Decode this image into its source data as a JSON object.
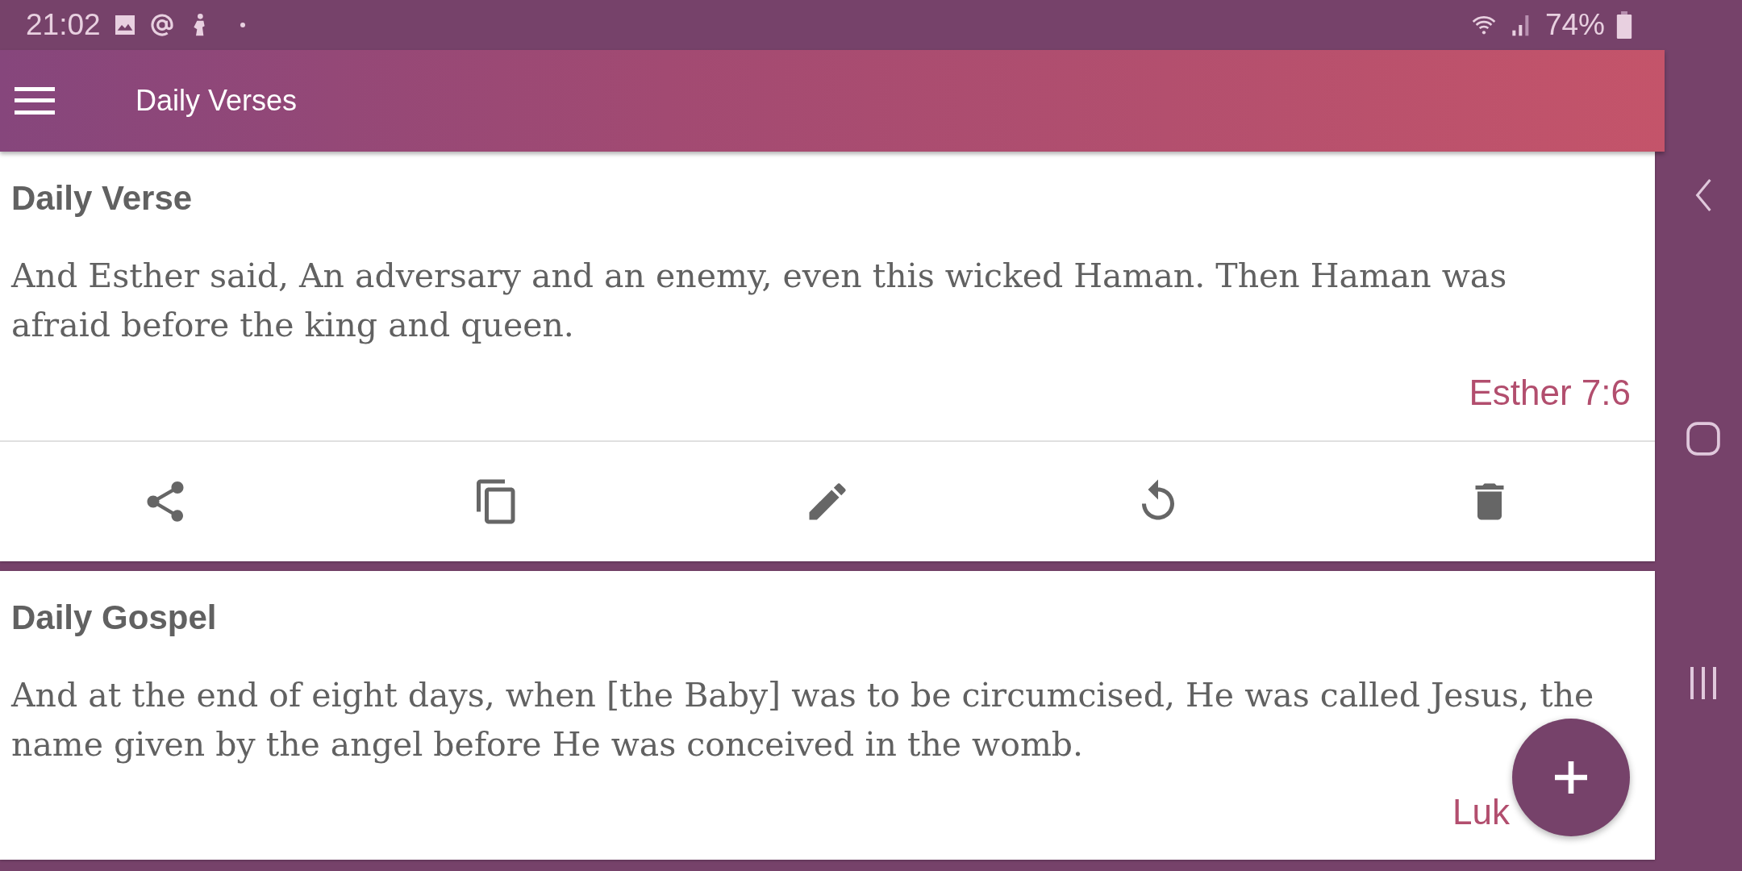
{
  "status_bar": {
    "time": "21:02",
    "battery": "74%"
  },
  "app_bar": {
    "title": "Daily Verses"
  },
  "cards": [
    {
      "title": "Daily Verse",
      "text": "And Esther said, An adversary and an enemy, even this wicked Haman. Then Haman was afraid before the king and queen.",
      "reference": "Esther 7:6",
      "reference_covered": false,
      "actions": [
        {
          "kind": "share"
        },
        {
          "kind": "copy"
        },
        {
          "kind": "edit"
        },
        {
          "kind": "undo"
        },
        {
          "kind": "delete"
        }
      ]
    },
    {
      "title": "Daily Gospel",
      "text": "And at the end of eight days, when [the Baby] was to be circumcised, He was called Jesus, the name given by the angel before He was conceived in the womb.",
      "reference": "Luk",
      "reference_covered": true
    }
  ]
}
